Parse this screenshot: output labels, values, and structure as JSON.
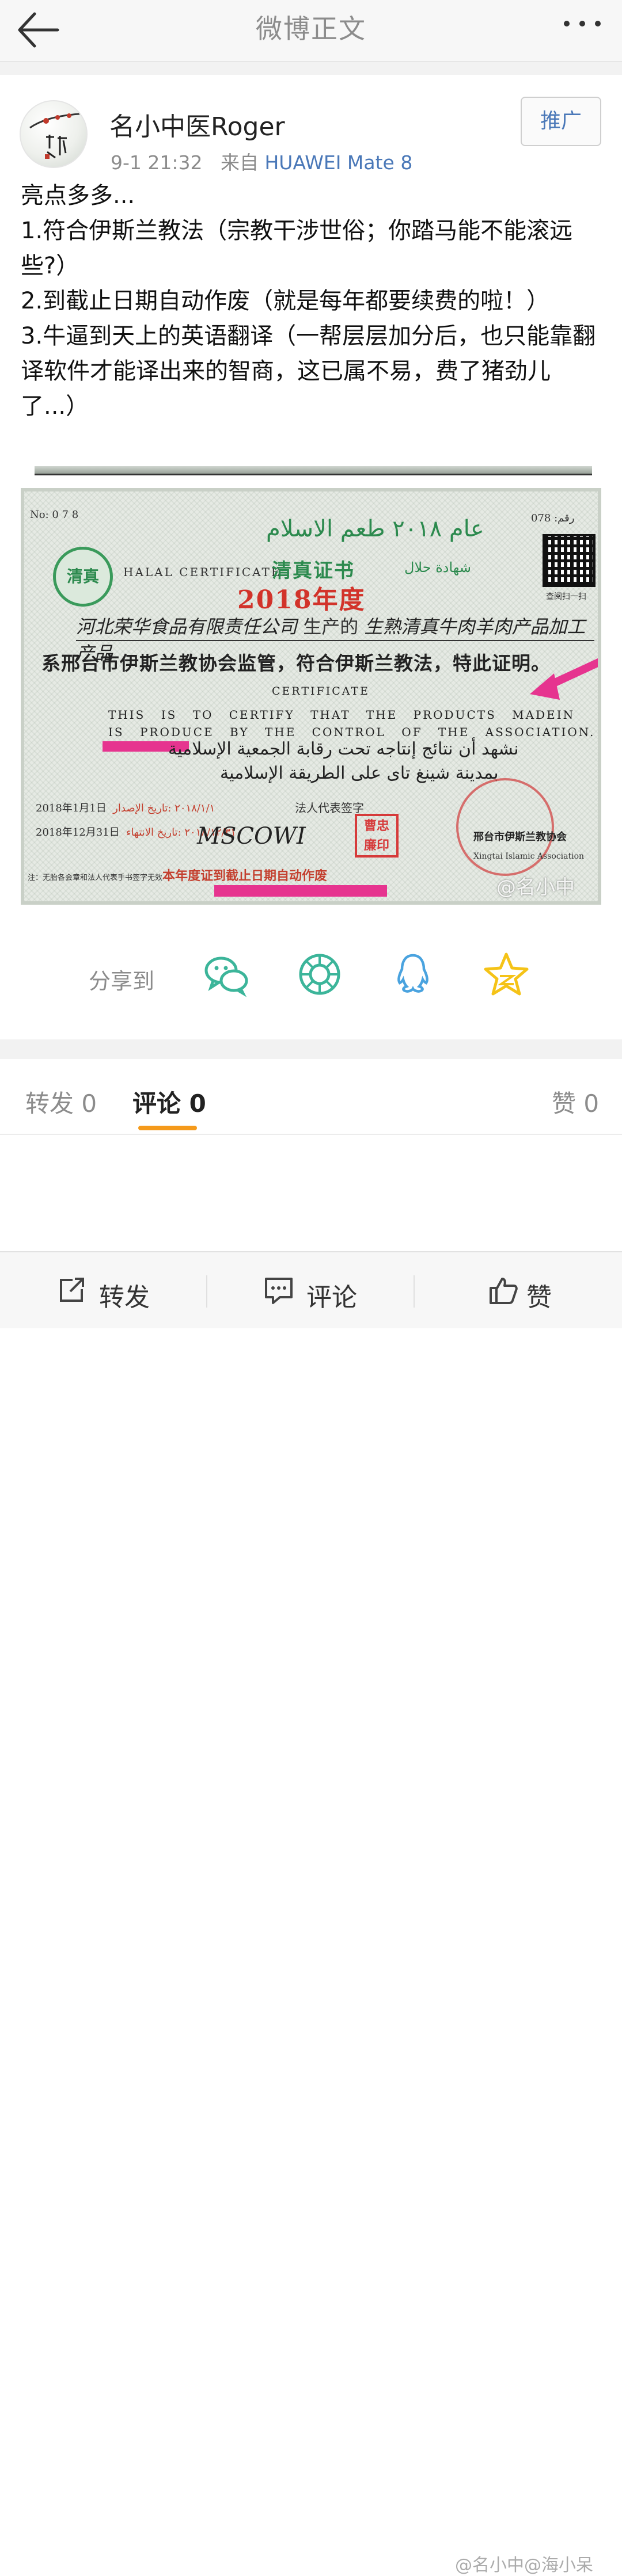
{
  "topbar": {
    "title": "微博正文",
    "back_icon": "arrow-left-icon",
    "more_icon": "more-horizontal-icon"
  },
  "post": {
    "author": "名小中医Roger",
    "time": "9-1 21:32",
    "source_prefix": "来自",
    "device": "HUAWEI Mate 8",
    "promote_label": "推广",
    "content_lines": [
      "亮点多多...",
      "1.符合伊斯兰教法（宗教干涉世俗；你踏马能不能滚远些?）",
      "2.到截止日期自动作废（就是每年都要续费的啦！）",
      "3.牛逼到天上的英语翻译（一帮层层加分后，也只能靠翻译软件才能译出来的智商，这已属不易，费了猪劲儿了...）"
    ]
  },
  "certificate": {
    "no_left": "No: 0 7 8",
    "no_right": "078 :رقم",
    "arabic_top": "عام ٢٠١٨ طعم الاسلام",
    "halal_logo": "清真",
    "halal_en": "HALAL CERTIFICATE",
    "title_zh": "清真证书",
    "title_ar": "شهادة حلال",
    "qr_caption": "查阅扫一扫",
    "year": "2018年度",
    "line1_prefix": "",
    "line1_hand": "河北荣华食品有限责任公司",
    "line1_mid": "生产的",
    "line1_product": "生熟清真牛肉羊肉产品加工产品",
    "line2": "系邢台市伊斯兰教协会监管，符合伊斯兰教法，特此证明。",
    "en_head": "CERTIFICATE",
    "en_line1": "THIS IS TO CERTIFY THAT THE PRODUCTS MADEIN",
    "en_line2": "IS PRODUCE BY THE CONTROL OF THE ASSOCIATION.",
    "ar_line1": "نشهد أن نتائج إنتاجه تحت رقابة الجمعية الإسلامية",
    "ar_line2": "بمدينة شينغ تاى على الطريقة الإسلامية",
    "date_issue": "2018年1月1日",
    "date_valid": "2018年12月31日",
    "date_issue_ar": "٢٠١٨/١/١ :تاريخ الإصدار",
    "date_valid_ar": "٢٠١٨/١٢/٣١ :تاريخ الانتهاء",
    "legal_rep": "法人代表签字",
    "signature": "MSCOWI",
    "small_seal": "曹忠 廉印",
    "assoc_zh": "邢台市伊斯兰教协会",
    "assoc_en": "Xingtai Islamic Association",
    "footnote": "注：无胎各会章和法人代表手书签字无效",
    "footer_red": "本年度证到截止日期自动作废",
    "watermark": "@名小中"
  },
  "share": {
    "label": "分享到",
    "targets": [
      {
        "name": "wechat",
        "icon": "wechat-icon",
        "color": "#3cb59a"
      },
      {
        "name": "moments",
        "icon": "moments-icon",
        "color": "#3cb59a"
      },
      {
        "name": "qq",
        "icon": "qq-icon",
        "color": "#4aa3df"
      },
      {
        "name": "qzone",
        "icon": "qzone-star-icon",
        "color": "#f5c317"
      }
    ]
  },
  "tabs": {
    "repost": "转发 0",
    "comments": "评论 0",
    "likes": "赞 0",
    "active_color": "#f59a1b"
  },
  "bottombar": {
    "repost": "转发",
    "comment": "评论",
    "like": "赞"
  },
  "footer_watermark": "@名小中@海小呆"
}
